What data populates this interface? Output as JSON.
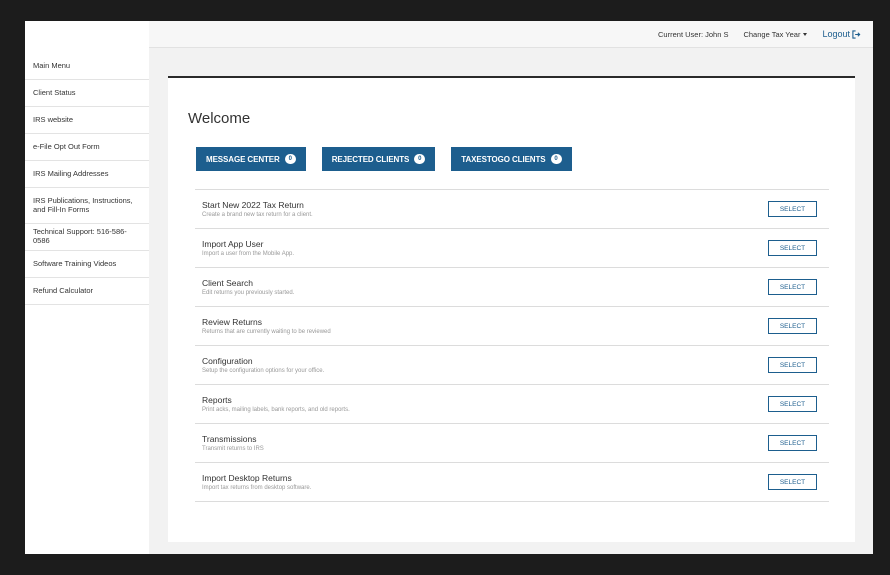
{
  "sidebar": {
    "items": [
      {
        "label": "Main Menu"
      },
      {
        "label": "Client Status"
      },
      {
        "label": "IRS website"
      },
      {
        "label": "e-File Opt Out Form"
      },
      {
        "label": "IRS Mailing Addresses"
      },
      {
        "label": "IRS Publications, Instructions, and Fill-In Forms"
      },
      {
        "label": "Technical Support: 516-586-0586"
      },
      {
        "label": "Software Training Videos"
      },
      {
        "label": "Refund Calculator"
      }
    ]
  },
  "topbar": {
    "current_user": "Current User: John S",
    "change_year": "Change Tax Year",
    "logout": "Logout"
  },
  "main": {
    "welcome": "Welcome",
    "pills": [
      {
        "label": "MESSAGE CENTER",
        "count": "0"
      },
      {
        "label": "REJECTED CLIENTS",
        "count": "0"
      },
      {
        "label": "TAXESTOGO CLIENTS",
        "count": "0"
      }
    ],
    "select_label": "SELECT",
    "rows": [
      {
        "title": "Start New 2022 Tax Return",
        "desc": "Create a brand new tax return for a client."
      },
      {
        "title": "Import App User",
        "desc": "Import a user from the Mobile App."
      },
      {
        "title": "Client Search",
        "desc": "Edit returns you previously started."
      },
      {
        "title": "Review Returns",
        "desc": "Returns that are currently waiting to be reviewed"
      },
      {
        "title": "Configuration",
        "desc": "Setup the configuration options for your office."
      },
      {
        "title": "Reports",
        "desc": "Print acks, mailing labels, bank reports, and old reports."
      },
      {
        "title": "Transmissions",
        "desc": "Transmit returns to IRS"
      },
      {
        "title": "Import Desktop Returns",
        "desc": "Import tax returns from desktop software."
      }
    ]
  },
  "colors": {
    "accent": "#1d5e8e",
    "background": "#1c1c1c"
  }
}
